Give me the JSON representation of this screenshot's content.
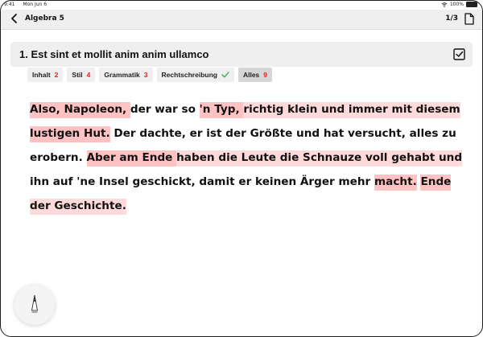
{
  "status_bar": {
    "time": "9:41",
    "date": "Mon Jun 6",
    "battery": "100%",
    "battery_level": 1.0
  },
  "nav": {
    "title": "Algebra 5",
    "page_counter": "1/3"
  },
  "question": {
    "title": "1. Est sint et mollit anim anim ullamco"
  },
  "tabs": [
    {
      "label": "Inhalt",
      "count": "2"
    },
    {
      "label": "Stil",
      "count": "4"
    },
    {
      "label": "Grammatik",
      "count": "3"
    },
    {
      "label": "Rechtschreibung"
    },
    {
      "label": "Alles",
      "count": "9"
    }
  ],
  "text": {
    "lines": [
      [
        {
          "t": "Also, Napoleon, ",
          "h": 1
        },
        {
          "t": "der war so "
        },
        {
          "t": "'n Typ, ",
          "h": 1
        },
        {
          "t": "richtig klein und immer mit diesem",
          "h": 2
        }
      ],
      [
        {
          "t": "lustigen Hut.",
          "h": 1
        },
        {
          "t": " Der dachte, er ist der Größte und hat versucht, alles zu"
        }
      ],
      [
        {
          "t": "erobern. "
        },
        {
          "t": "Aber am Ende ",
          "h": 1
        },
        {
          "t": "haben die Leute die Schnauze voll gehabt und",
          "h": 2
        }
      ],
      [
        {
          "t": "ihn auf 'ne Insel geschickt, damit er keinen Ärger mehr "
        },
        {
          "t": "macht.",
          "h": 1
        },
        {
          "t": " "
        },
        {
          "t": "Ende",
          "h": 1
        }
      ],
      [
        {
          "t": "der Geschichte.",
          "h": 2
        }
      ]
    ]
  }
}
